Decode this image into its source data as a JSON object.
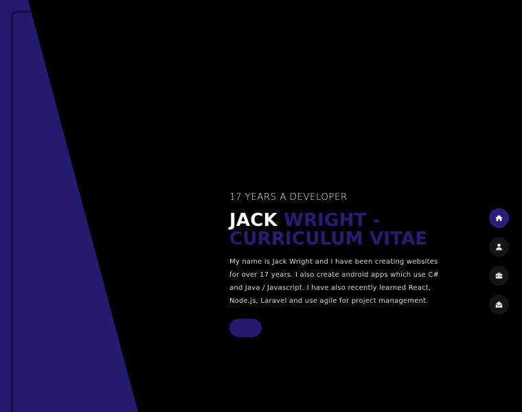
{
  "colors": {
    "background": "#000000",
    "panel": "#241a6e",
    "accent": "#2b1a78",
    "title_white": "#ffffff",
    "nav_active": "#2a1f78",
    "nav_inactive": "#141414"
  },
  "hero": {
    "subtitle": "17 YEARS A DEVELOPER",
    "title_first": "JACK ",
    "title_accent": "WRIGHT - CURRICULUM VITAE",
    "description": "My name is Jack Wright and I have been creating websites for over 17 years. I also create android apps which use C# and Java / Javascript. I have also recently learned React, Node.js, Laravel and use agile for project management.",
    "button_label": ""
  },
  "side_nav": {
    "items": [
      {
        "icon": "home-icon",
        "active": true
      },
      {
        "icon": "user-icon",
        "active": false
      },
      {
        "icon": "briefcase-icon",
        "active": false
      },
      {
        "icon": "envelope-open-icon",
        "active": false
      }
    ]
  }
}
